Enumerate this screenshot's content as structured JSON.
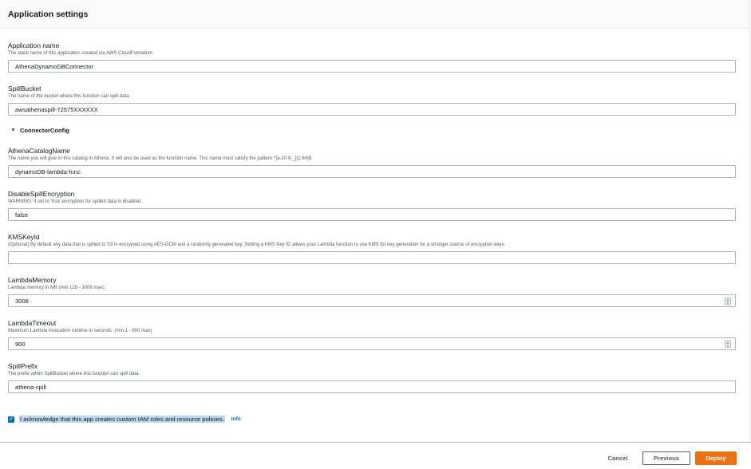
{
  "panel": {
    "title": "Application settings"
  },
  "fields": {
    "app_name": {
      "label": "Application name",
      "description": "The stack name of this application created via AWS CloudFormation",
      "value": "AthenaDynamoDBConnector"
    },
    "spill_bucket": {
      "label": "SpillBucket",
      "description": "The name of the bucket where this function can spill data.",
      "value": "awsathenaspill-72575XXXXXX"
    },
    "catalog_name": {
      "label": "AthenaCatalogName",
      "description": "The name you will give to this catalog in Athena. It will also be used as the function name. This name must satisfy the pattern ^[a-z0-9-_]{1,64}$",
      "value": "dynamoDB-lambda-func"
    },
    "disable_spill_encryption": {
      "label": "DisableSpillEncryption",
      "description": "WARNING: If set to 'true' encryption for spilled data is disabled.",
      "value": "false"
    },
    "kms_key_id": {
      "label": "KMSKeyId",
      "description": "(Optional) By default any data that is spilled to S3 is encrypted using AES-GCM and a randomly generated key. Setting a KMS Key ID allows your Lambda function to use KMS for key generation for a stronger source of encryption keys.",
      "value": ""
    },
    "lambda_memory": {
      "label": "LambdaMemory",
      "description": "Lambda memory in MB (min 128 - 3008 max).",
      "value": "3008"
    },
    "lambda_timeout": {
      "label": "LambdaTimeout",
      "description": "Maximum Lambda invocation runtime in seconds. (min 1 - 900 max)",
      "value": "900"
    },
    "spill_prefix": {
      "label": "SpillPrefix",
      "description": "The prefix within SpillBucket where this function can spill data.",
      "value": "athena-spill"
    }
  },
  "section": {
    "label": "ConnectorConfig",
    "icon": "caret-down-icon"
  },
  "acknowledge": {
    "checked": true,
    "text": "I acknowledge that this app creates custom IAM roles and resource policies.",
    "info": "Info"
  },
  "footer": {
    "cancel": "Cancel",
    "previous": "Previous",
    "deploy": "Deploy"
  },
  "colors": {
    "accent": "#0073bb",
    "primary_button": "#ec7211",
    "highlight": "#bcd7f2"
  }
}
